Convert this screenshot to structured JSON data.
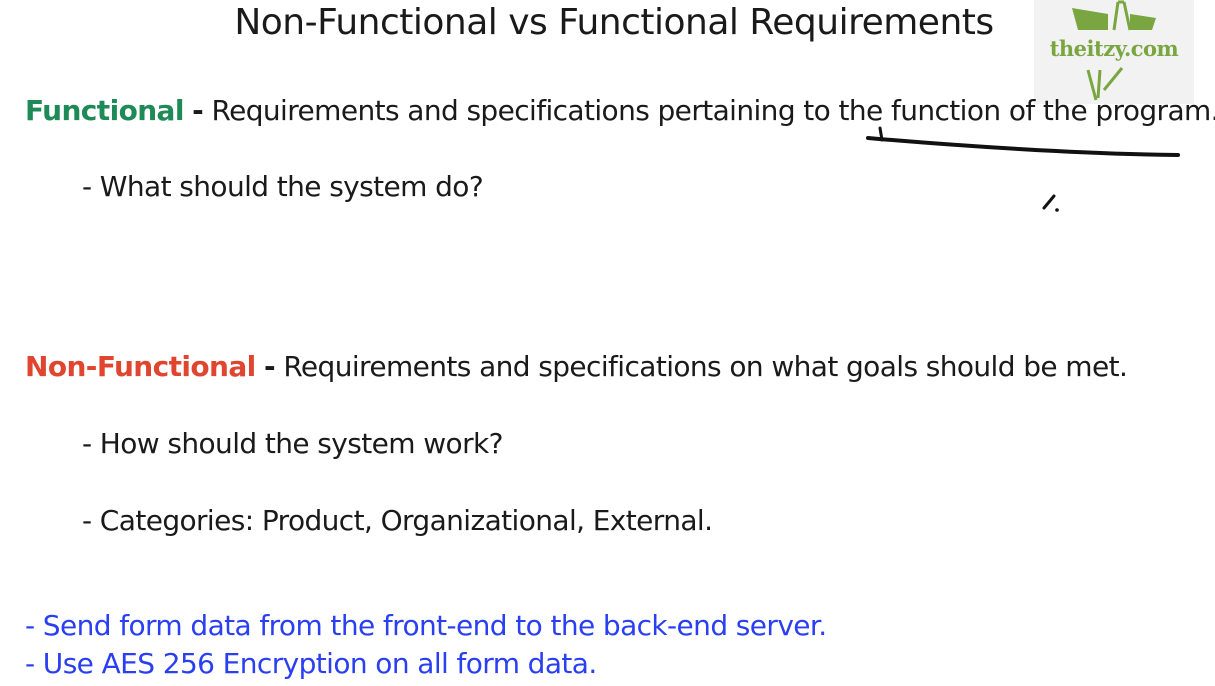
{
  "slide": {
    "title": "Non-Functional vs Functional Requirements"
  },
  "functional": {
    "term": "Functional",
    "separator": "-",
    "definition": "Requirements and specifications pertaining to the function of the program.",
    "bullet": "- What should the system do?"
  },
  "non_functional": {
    "term": "Non-Functional",
    "separator": "-",
    "definition": "Requirements and specifications on what goals should be met.",
    "bullets": [
      "- How should the system work?",
      "- Categories: Product, Organizational, External."
    ]
  },
  "examples": [
    "- Send form data from the front-end to the back-end server.",
    "- Use AES 256 Encryption on all form data."
  ],
  "watermark": {
    "text": "theitzy.com",
    "icon": "theitzy-logo-icon"
  },
  "annotation": {
    "icon": "pen-cursor-icon"
  },
  "colors": {
    "functional": "#1e8a57",
    "non_functional": "#e0452f",
    "examples": "#2a3ff2",
    "logo": "#7aa641"
  }
}
